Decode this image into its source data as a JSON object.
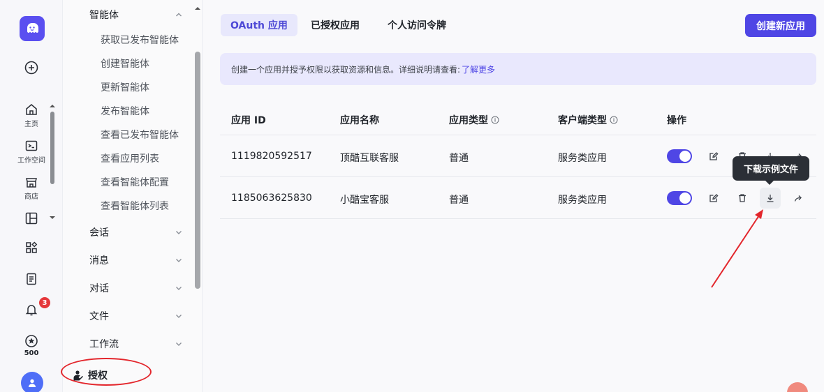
{
  "rail": {
    "home_label": "主页",
    "workspace_label": "工作空间",
    "store_label": "商店",
    "notification_badge": "3",
    "points": "500"
  },
  "menu": {
    "section_agent": "智能体",
    "agent_items": [
      "获取已发布智能体",
      "创建智能体",
      "更新智能体",
      "发布智能体",
      "查看已发布智能体",
      "查看应用列表",
      "查看智能体配置",
      "查看智能体列表"
    ],
    "sections": [
      "会话",
      "消息",
      "对话",
      "文件",
      "工作流"
    ],
    "auth": "授权"
  },
  "tabs": [
    "OAuth 应用",
    "已授权应用",
    "个人访问令牌"
  ],
  "create_button": "创建新应用",
  "info": {
    "text": "创建一个应用并授予权限以获取资源和信息。详细说明请查看:",
    "link": "了解更多"
  },
  "table": {
    "headers": [
      "应用 ID",
      "应用名称",
      "应用类型",
      "客户端类型",
      "操作"
    ],
    "rows": [
      [
        "1119820592517",
        "顶酷互联客服",
        "普通",
        "服务类应用"
      ],
      [
        "1185063625830",
        "小酷宝客服",
        "普通",
        "服务类应用"
      ]
    ]
  },
  "tooltip": "下载示例文件",
  "colors": {
    "accent": "#4f46e5",
    "annotation": "#e3262c"
  }
}
